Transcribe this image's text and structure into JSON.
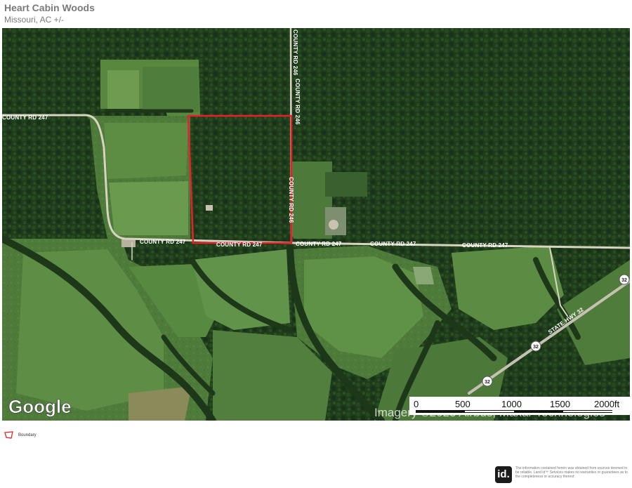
{
  "header": {
    "title": "Heart Cabin Woods",
    "subtitle": "Missouri,  AC +/-"
  },
  "map": {
    "road_labels": {
      "county_rd_247_west": "COUNTY RD 247",
      "county_rd_247_a": "COUNTY RD 247",
      "county_rd_247_b": "COUNTY RD 247",
      "county_rd_247_c": "COUNTY RD 247",
      "county_rd_247_d": "COUNTY RD 247",
      "county_rd_247_e": "COUNTY RD 247",
      "county_rd_246_north": "COUNTY RD 246",
      "county_rd_246_south": "COUNTY RD 246",
      "state_hwy_32": "STATE HWY 32"
    },
    "shields": [
      "32",
      "32",
      "32"
    ],
    "google_logo": "Google",
    "imagery_credit": "Imagery ©2023 Airbus, Maxar Technologies",
    "scale": {
      "ticks": [
        "0",
        "500",
        "1000",
        "1500",
        "2000ft"
      ]
    },
    "boundary_color": "#e8202a"
  },
  "legend": {
    "label": "Boundary",
    "icon": "boundary-polygon-icon"
  },
  "footer": {
    "logo": "id.",
    "disclaimer": "The information contained herein was obtained from sources deemed to be reliable. Land id™ Services makes no warranties or guarantees as to the completeness or accuracy thereof."
  }
}
